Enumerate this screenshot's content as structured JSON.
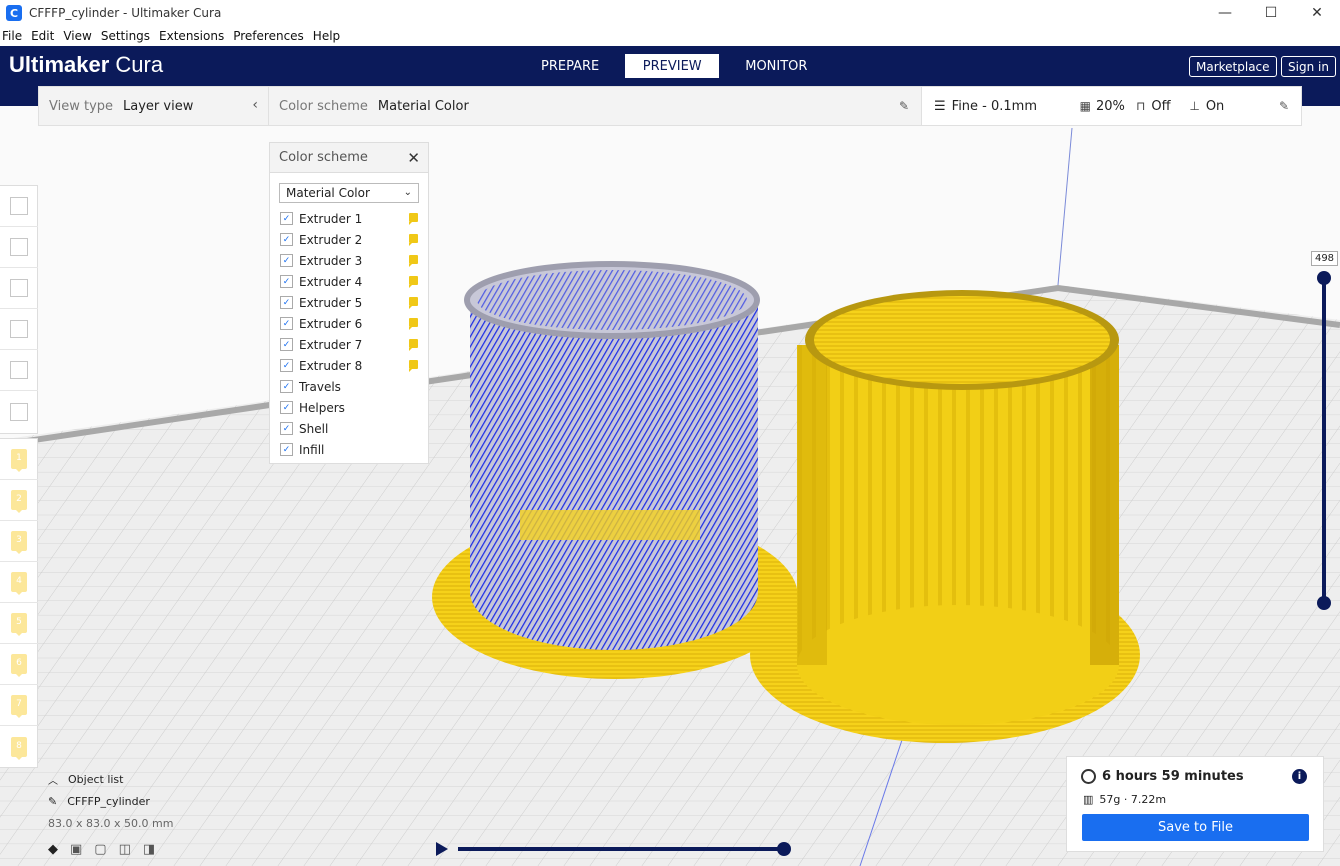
{
  "window": {
    "title": "CFFFP_cylinder - Ultimaker Cura",
    "app_icon_letter": "C",
    "controls": [
      "—",
      "☐",
      "✕"
    ]
  },
  "menu": [
    "File",
    "Edit",
    "View",
    "Settings",
    "Extensions",
    "Preferences",
    "Help"
  ],
  "header": {
    "logo_bold": "Ultimaker",
    "logo_light": "Cura",
    "tabs": [
      "PREPARE",
      "PREVIEW",
      "MONITOR"
    ],
    "active_tab": "PREVIEW",
    "marketplace_label": "Marketplace",
    "signin_label": "Sign in",
    "bg_color": "#0b1a5a"
  },
  "viewbar": {
    "view_type_label": "View type",
    "view_type_value": "Layer view",
    "color_scheme_label": "Color scheme",
    "color_scheme_value": "Material Color"
  },
  "print_settings": {
    "profile": "Fine - 0.1mm",
    "infill": "20%",
    "support": "Off",
    "adhesion": "On"
  },
  "color_scheme_panel": {
    "title": "Color scheme",
    "selected": "Material Color",
    "extruders": [
      "Extruder 1",
      "Extruder 2",
      "Extruder 3",
      "Extruder 4",
      "Extruder 5",
      "Extruder 6",
      "Extruder 7",
      "Extruder 8"
    ],
    "extruder_color": "#f0c817",
    "options": [
      "Travels",
      "Helpers",
      "Shell",
      "Infill"
    ]
  },
  "extruder_badges": [
    "1",
    "2",
    "3",
    "4",
    "5",
    "6",
    "7",
    "8"
  ],
  "layer_slider": {
    "current_layer": "498"
  },
  "object_list": {
    "header": "Object list",
    "object_name": "CFFFP_cylinder",
    "dimensions": "83.0 x 83.0 x 50.0 mm"
  },
  "print_info": {
    "time": "6 hours 59 minutes",
    "material": "57g · 7.22m",
    "save_label": "Save to File"
  },
  "colors": {
    "accent": "#196ef0",
    "yellow_model": "#f5d21a",
    "blue_travel": "#1e2ee6"
  }
}
